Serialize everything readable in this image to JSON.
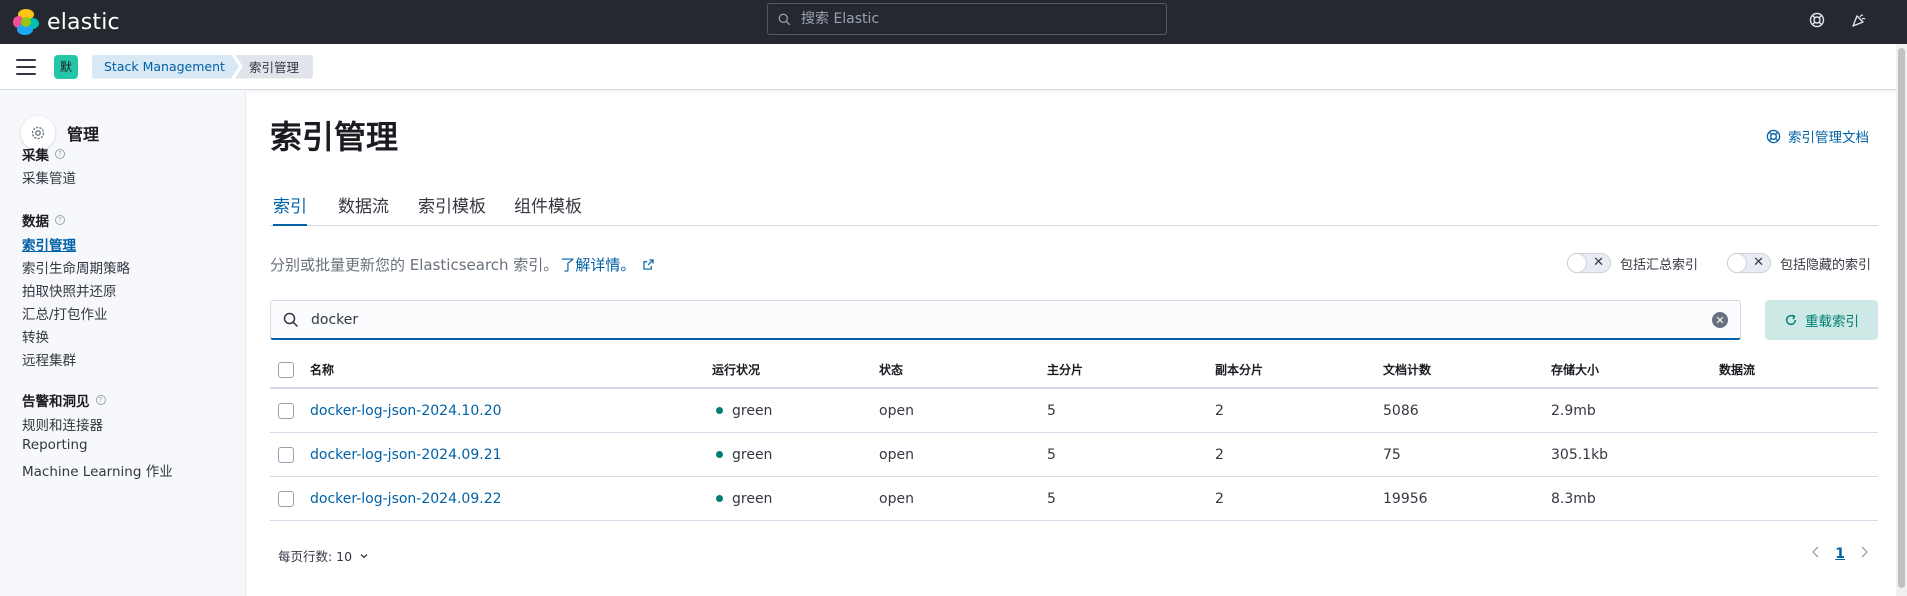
{
  "header": {
    "brand": "elastic",
    "search_placeholder": "搜索 Elastic"
  },
  "subbar": {
    "space_initial": "默",
    "breadcrumbs": [
      "Stack Management",
      "索引管理"
    ]
  },
  "sidebar": {
    "title": "管理",
    "sections": [
      {
        "label": "采集",
        "items": [
          "采集管道"
        ]
      },
      {
        "label": "数据",
        "items": [
          "索引管理",
          "索引生命周期策略",
          "拍取快照并还原",
          "汇总/打包作业",
          "转换",
          "远程集群"
        ]
      },
      {
        "label": "告警和洞见",
        "items": [
          "规则和连接器",
          "Reporting",
          "Machine Learning 作业"
        ]
      }
    ],
    "active_item": "索引管理"
  },
  "main": {
    "title": "索引管理",
    "docs_link": "索引管理文档",
    "tabs": [
      "索引",
      "数据流",
      "索引模板",
      "组件模板"
    ],
    "active_tab": "索引",
    "description": "分别或批量更新您的 Elasticsearch 索引。",
    "learn_more": "了解详情。",
    "toggles": [
      "包括汇总索引",
      "包括隐藏的索引"
    ],
    "search_value": "docker",
    "reload_label": "重载索引"
  },
  "table": {
    "columns": [
      "名称",
      "运行状况",
      "状态",
      "主分片",
      "副本分片",
      "文档计数",
      "存储大小",
      "数据流"
    ],
    "rows": [
      {
        "name": "docker-log-json-2024.10.20",
        "health": "green",
        "status": "open",
        "primary": "5",
        "replica": "2",
        "docs": "5086",
        "size": "2.9mb",
        "stream": ""
      },
      {
        "name": "docker-log-json-2024.09.21",
        "health": "green",
        "status": "open",
        "primary": "5",
        "replica": "2",
        "docs": "75",
        "size": "305.1kb",
        "stream": ""
      },
      {
        "name": "docker-log-json-2024.09.22",
        "health": "green",
        "status": "open",
        "primary": "5",
        "replica": "2",
        "docs": "19956",
        "size": "8.3mb",
        "stream": ""
      }
    ]
  },
  "pagination": {
    "rows_per_page": "每页行数: 10",
    "current_page": "1"
  },
  "colors": {
    "header_bg": "#25282f",
    "link": "#0061a6",
    "health_green": "#017d73",
    "space_avatar": "#25c6a8"
  }
}
